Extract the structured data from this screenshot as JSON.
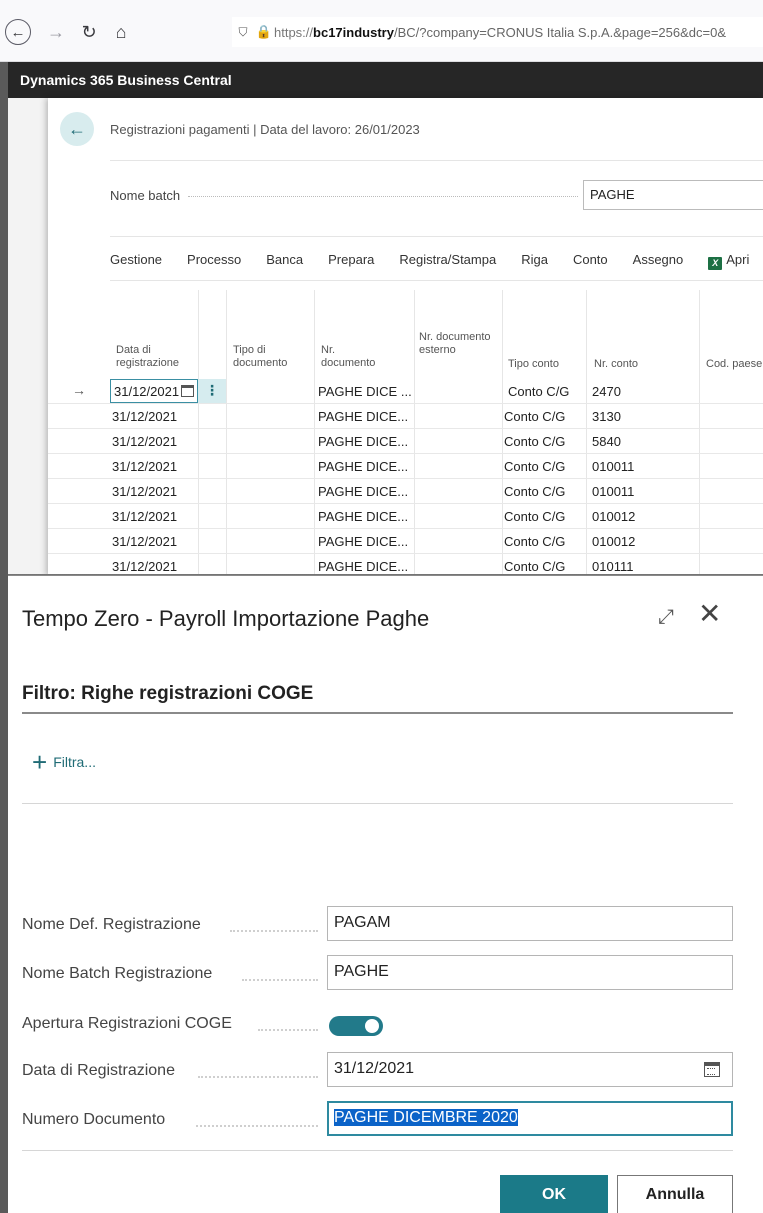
{
  "browser": {
    "url_protocol": "https://",
    "url_host": "bc17industry",
    "url_rest": "/BC/?company=CRONUS Italia S.p.A.&page=256&dc=0&"
  },
  "app": {
    "title": "Dynamics 365 Business Central"
  },
  "background_page": {
    "title": "Registrazioni pagamenti | Data del lavoro: 26/01/2023",
    "batch_label": "Nome batch",
    "batch_value": "PAGHE",
    "menu": [
      "Gestione",
      "Processo",
      "Banca",
      "Prepara",
      "Registra/Stampa",
      "Riga",
      "Conto",
      "Assegno"
    ],
    "menu_excel": "Apri",
    "columns": {
      "date": "Data di registrazione",
      "doc_type": "Tipo di documento",
      "doc_no": "Nr. documento",
      "ext_doc_no": "Nr. documento esterno",
      "account_type": "Tipo conto",
      "account_no": "Nr. conto",
      "country": "Cod. paese"
    },
    "active_date": "31/12/2021",
    "active_doc_no": "PAGHE DICE",
    "active_doc_ellipsis": "...",
    "row_menu": "⋮",
    "rows": [
      {
        "date": "31/12/2021",
        "doc_no": "PAGHE DICE...",
        "account_type": "Conto C/G",
        "account_no": "3130"
      },
      {
        "date": "31/12/2021",
        "doc_no": "PAGHE DICE...",
        "account_type": "Conto C/G",
        "account_no": "5840"
      },
      {
        "date": "31/12/2021",
        "doc_no": "PAGHE DICE...",
        "account_type": "Conto C/G",
        "account_no": "010011"
      },
      {
        "date": "31/12/2021",
        "doc_no": "PAGHE DICE...",
        "account_type": "Conto C/G",
        "account_no": "010011"
      },
      {
        "date": "31/12/2021",
        "doc_no": "PAGHE DICE...",
        "account_type": "Conto C/G",
        "account_no": "010012"
      },
      {
        "date": "31/12/2021",
        "doc_no": "PAGHE DICE...",
        "account_type": "Conto C/G",
        "account_no": "010012"
      },
      {
        "date": "31/12/2021",
        "doc_no": "PAGHE DICE...",
        "account_type": "Conto C/G",
        "account_no": "010111"
      }
    ],
    "active_row": {
      "account_type": "Conto C/G",
      "account_no": "2470"
    }
  },
  "dialog": {
    "title": "Tempo Zero - Payroll Importazione Paghe",
    "filter_title": "Filtro: Righe registrazioni COGE",
    "add_filter_label": "Filtra...",
    "fields": {
      "template_label": "Nome Def. Registrazione",
      "template_value": "PAGAM",
      "batch_label": "Nome Batch Registrazione",
      "batch_value": "PAGHE",
      "open_label": "Apertura Registrazioni COGE",
      "posting_date_label": "Data di Registrazione",
      "posting_date_value": "31/12/2021",
      "doc_no_label": "Numero Documento",
      "doc_no_value": "PAGHE DICEMBRE 2020"
    },
    "ok_label": "OK",
    "cancel_label": "Annulla"
  },
  "colors": {
    "accent": "#1b7a88",
    "header": "#262626",
    "selection": "#0b63c8"
  }
}
